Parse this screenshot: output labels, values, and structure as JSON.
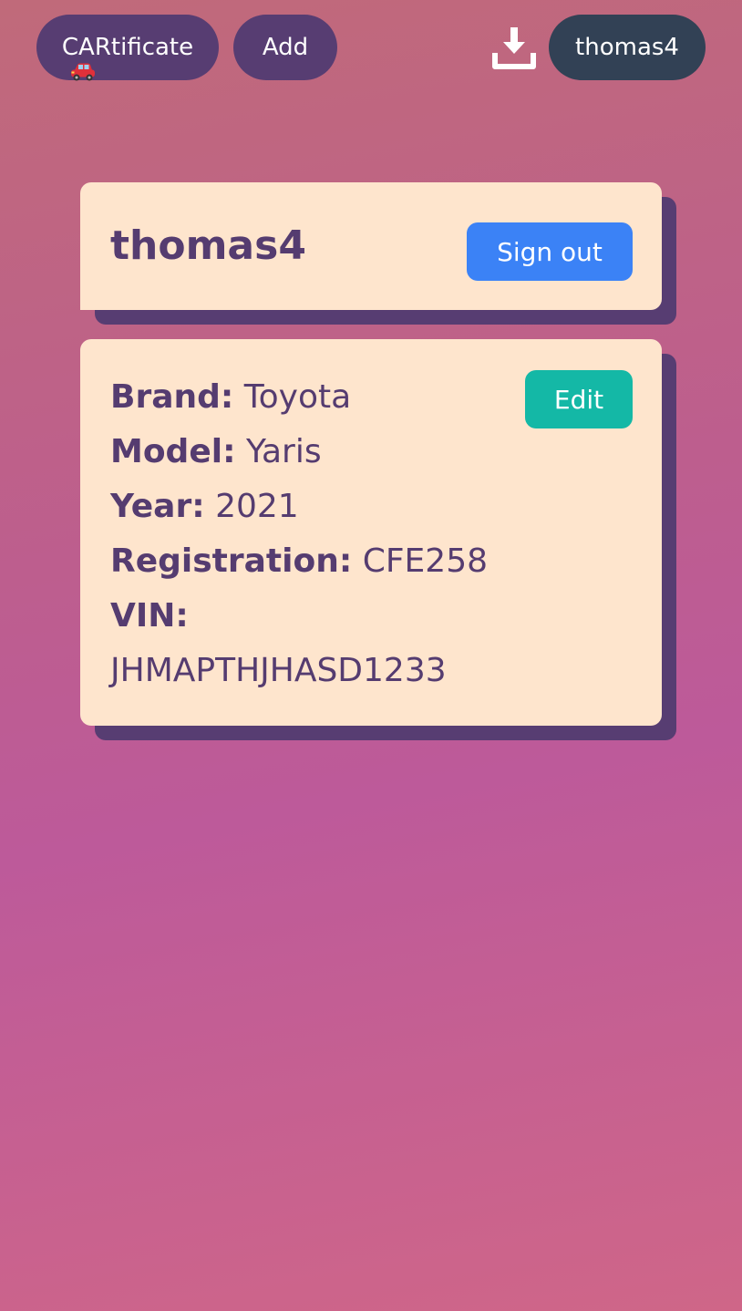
{
  "nav": {
    "brand_label": "CARtificate",
    "add_label": "Add",
    "user_label": "thomas4",
    "download_icon": "download-icon",
    "car_icon": "car-icon"
  },
  "profile": {
    "username": "thomas4",
    "signout_label": "Sign out"
  },
  "car": {
    "edit_label": "Edit",
    "fields": {
      "brand_label": "Brand:",
      "brand_value": "Toyota",
      "model_label": "Model:",
      "model_value": "Yaris",
      "year_label": "Year:",
      "year_value": "2021",
      "registration_label": "Registration:",
      "registration_value": "CFE258",
      "vin_label": "VIN:",
      "vin_value": "JHMAPTHJHASD1233"
    }
  },
  "colors": {
    "nav_pill": "#573d72",
    "user_pill": "#324155",
    "card_bg": "#fee5cd",
    "card_shadow": "#573d72",
    "signout": "#3b82f6",
    "edit": "#14b8a6",
    "text": "#553c70"
  }
}
